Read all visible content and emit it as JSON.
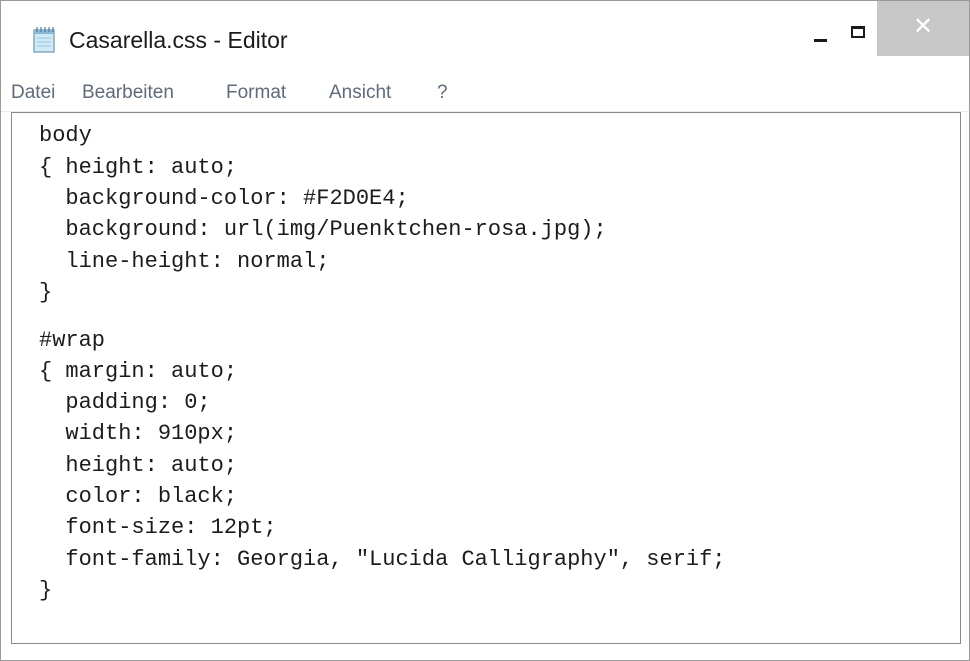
{
  "window": {
    "title": "Casarella.css - Editor",
    "controls": {
      "minimize_icon": "minimize-icon",
      "maximize_icon": "maximize-icon",
      "close_glyph": "✕",
      "close_hover_color": "#c7c7c7"
    }
  },
  "menubar": {
    "items": [
      {
        "label": "Datei"
      },
      {
        "label": "Bearbeiten"
      },
      {
        "label": "Format"
      },
      {
        "label": "Ansicht"
      },
      {
        "label": "?"
      }
    ],
    "text_color": "#5f6b7a"
  },
  "editor": {
    "lines": [
      "body",
      "{ height: auto;",
      "  background-color: #F2D0E4;",
      "  background: url(img/Puenktchen-rosa.jpg);",
      "  line-height: normal;",
      "}",
      "#wrap",
      "{ margin: auto;",
      "  padding: 0;",
      "  width: 910px;",
      "  height: auto;",
      "  color: black;",
      "  font-size: 12pt;",
      "  font-family: Georgia, \"Lucida Calligraphy\", serif;",
      "}"
    ]
  }
}
